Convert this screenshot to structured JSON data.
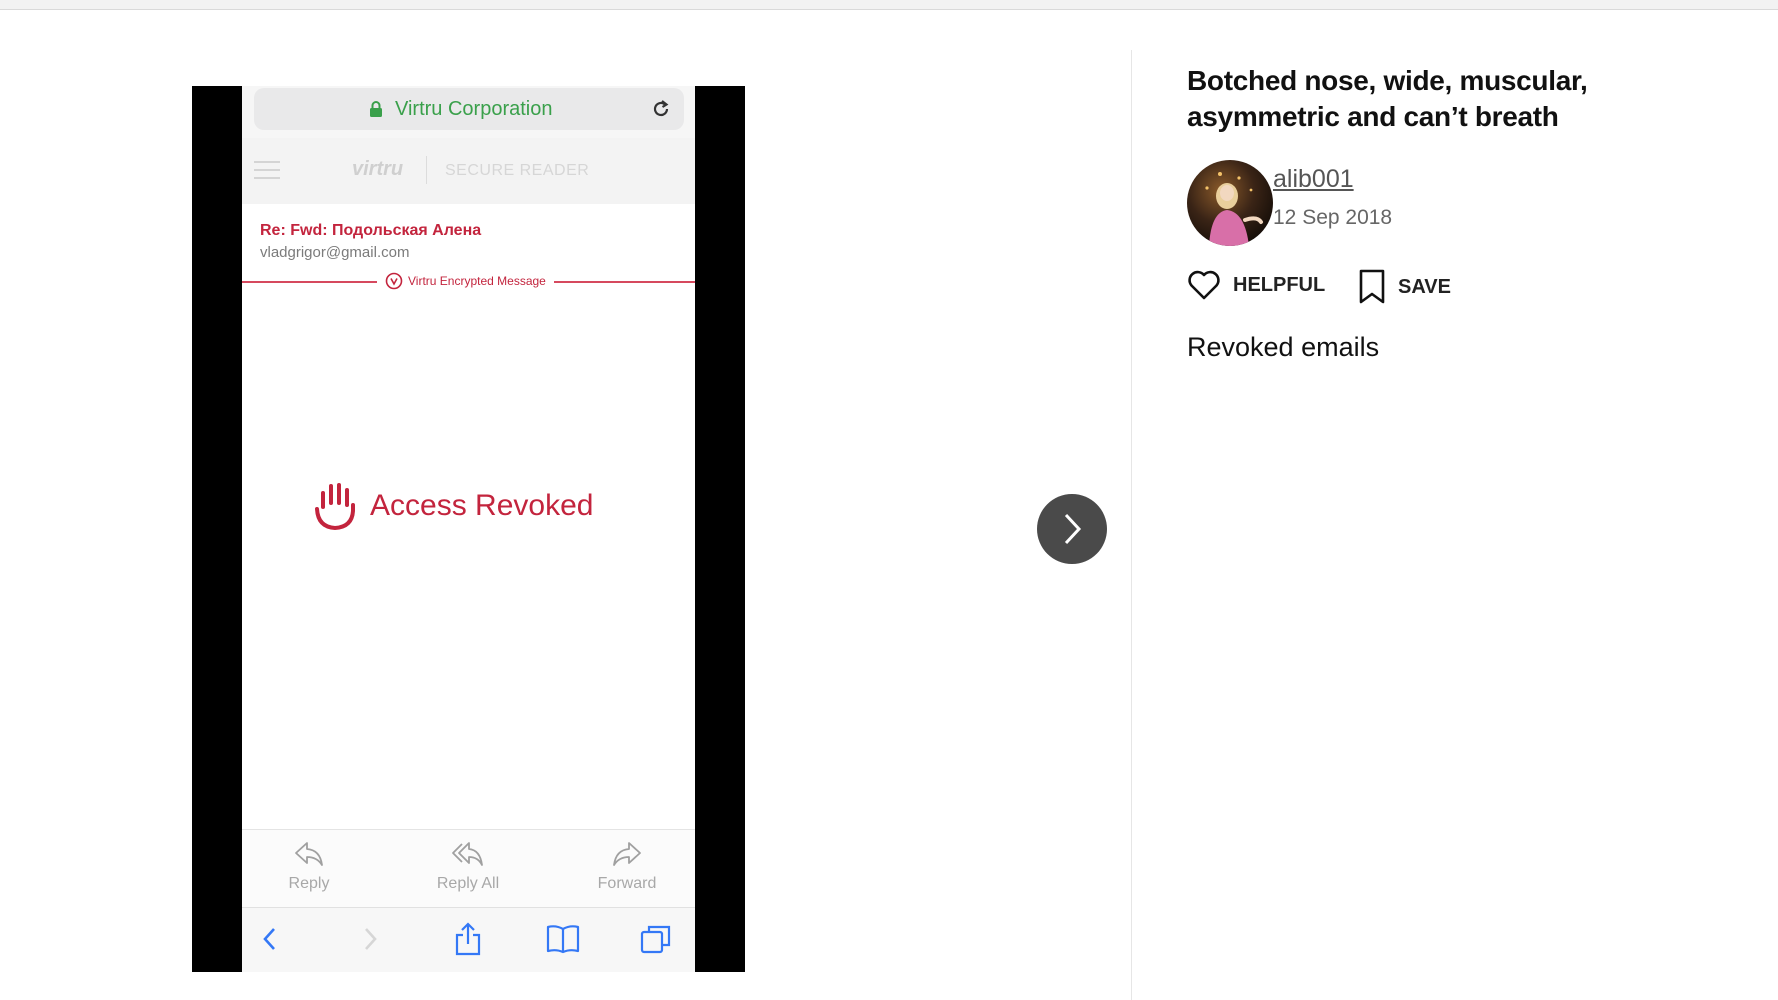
{
  "screenshot": {
    "url_text": "Virtru Corporation",
    "logo_text": "virtru",
    "reader_label": "SECURE READER",
    "subject": "Re: Fwd: Подольская Алена",
    "sender": "vladgrigor@gmail.com",
    "encrypted_label": "Virtru Encrypted Message",
    "revoked_text": "Access Revoked",
    "actions": [
      {
        "label": "Reply"
      },
      {
        "label": "Reply All"
      },
      {
        "label": "Forward"
      }
    ],
    "accent_color": "#c3243d"
  },
  "post": {
    "title": "Botched nose, wide, muscular, asymmetric and can’t breath",
    "author": "alib001",
    "date": "12 Sep 2018",
    "helpful_label": "HELPFUL",
    "save_label": "SAVE",
    "body": "Revoked emails"
  }
}
